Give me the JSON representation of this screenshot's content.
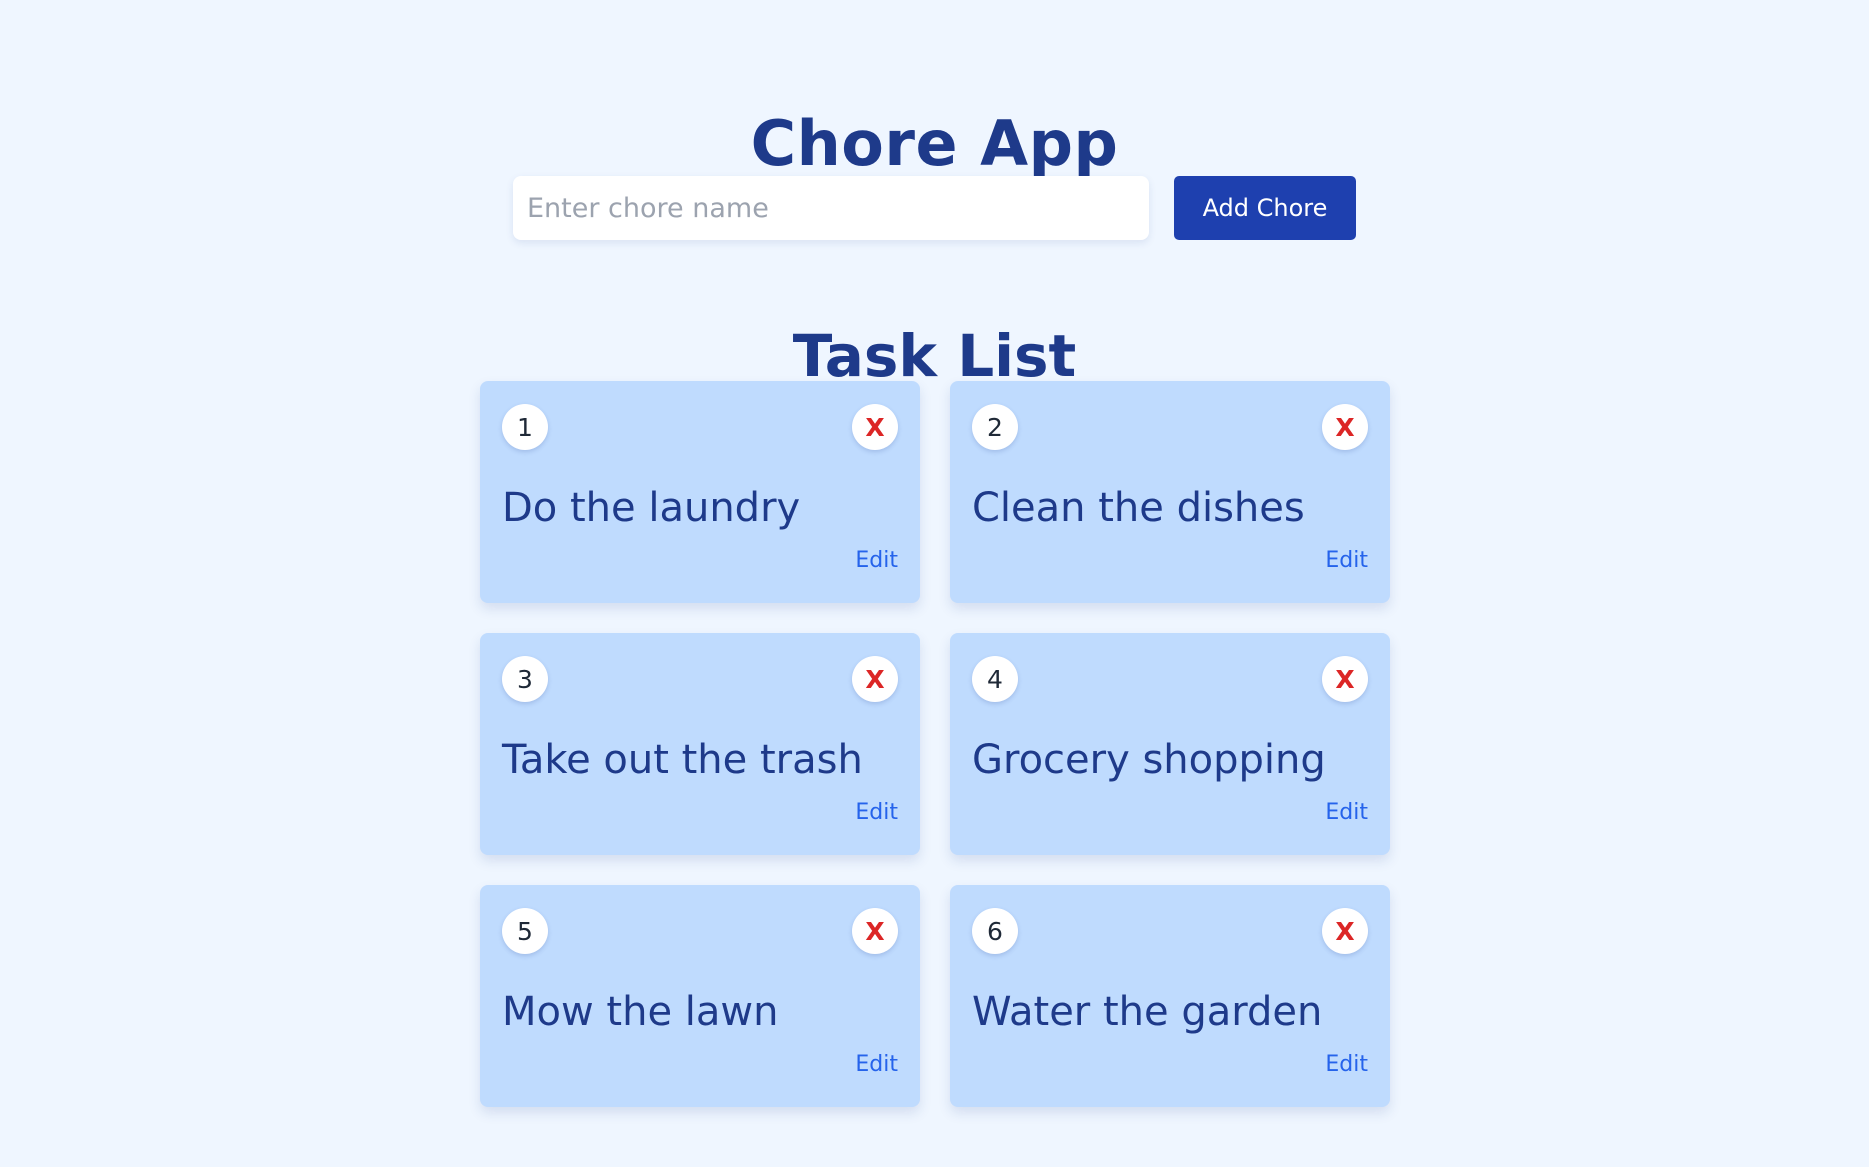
{
  "app": {
    "title": "Chore App",
    "input_placeholder": "Enter chore name",
    "input_value": "",
    "add_button_label": "Add Chore"
  },
  "task_list": {
    "title": "Task List",
    "delete_label": "X",
    "edit_label": "Edit",
    "items": [
      {
        "number": "1",
        "name": "Do the laundry"
      },
      {
        "number": "2",
        "name": "Clean the dishes"
      },
      {
        "number": "3",
        "name": "Take out the trash"
      },
      {
        "number": "4",
        "name": "Grocery shopping"
      },
      {
        "number": "5",
        "name": "Mow the lawn"
      },
      {
        "number": "6",
        "name": "Water the garden"
      }
    ]
  },
  "colors": {
    "background": "#eff6ff",
    "card": "#bfdbfe",
    "heading": "#1e3a8a",
    "button": "#1e40af",
    "delete": "#dc2626",
    "edit_link": "#2563eb"
  }
}
